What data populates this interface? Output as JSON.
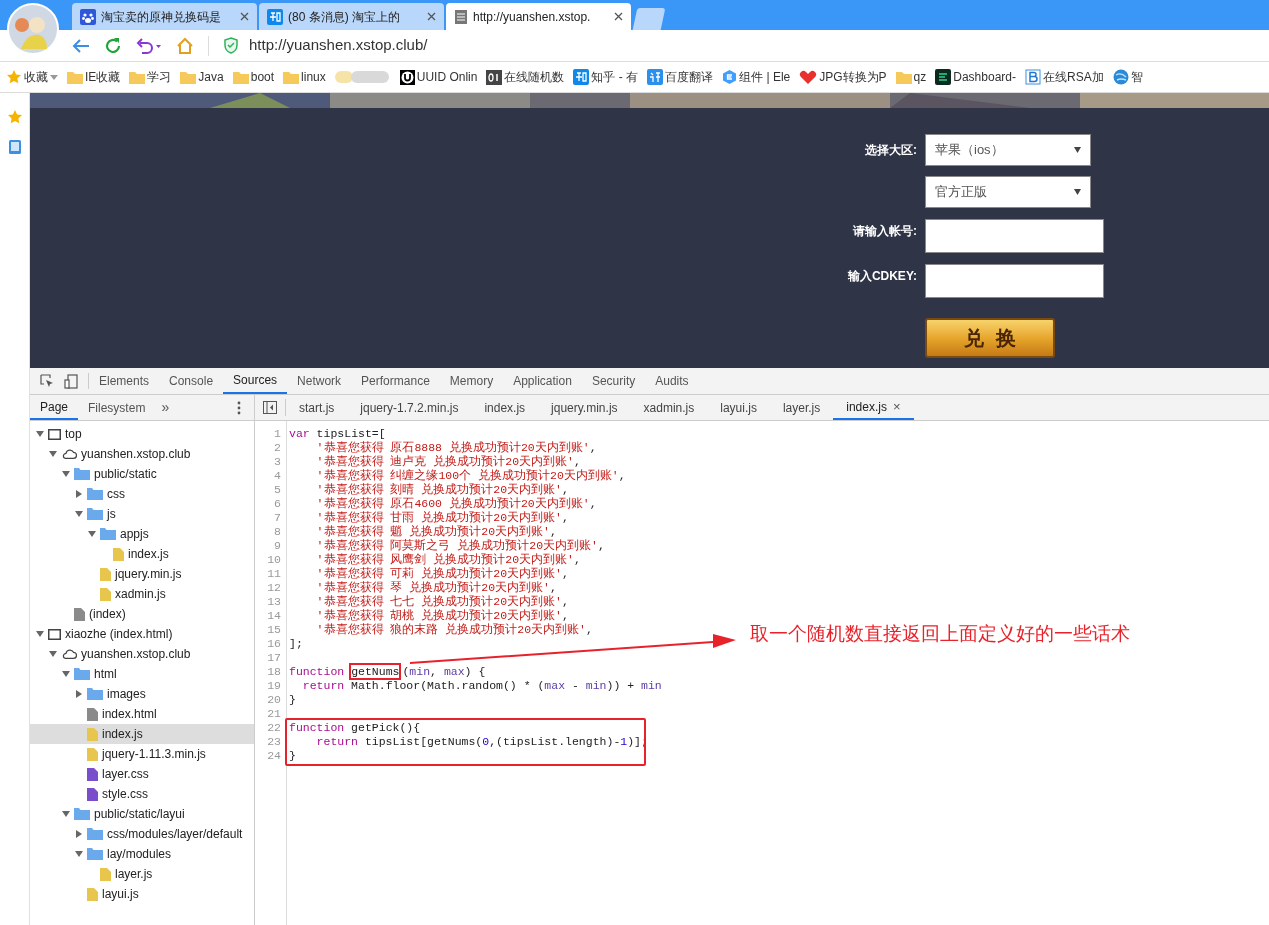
{
  "browser": {
    "tabs": [
      {
        "title": "淘宝卖的原神兑换码是",
        "kind": "paw",
        "selected": false
      },
      {
        "title": "(80 条消息) 淘宝上的",
        "kind": "zhihu",
        "selected": false
      },
      {
        "title": "http://yuanshen.xstop.",
        "kind": "page",
        "selected": true
      }
    ],
    "address": {
      "url": "http://yuanshen.xstop.club/"
    },
    "bookmarks": [
      {
        "label": "收藏",
        "kind": "star",
        "menu": true
      },
      {
        "label": "IE收藏",
        "kind": "folder"
      },
      {
        "label": "学习",
        "kind": "folder"
      },
      {
        "label": "Java",
        "kind": "folder"
      },
      {
        "label": "boot",
        "kind": "folder"
      },
      {
        "label": "linux",
        "kind": "folder"
      },
      {
        "kind": "blurred"
      },
      {
        "label": "UUID Onlin",
        "kind": "uuid"
      },
      {
        "label": "在线随机数",
        "kind": "binary"
      },
      {
        "label": "知乎 - 有",
        "kind": "zhihu"
      },
      {
        "label": "百度翻译",
        "kind": "translate"
      },
      {
        "label": "组件 | Ele",
        "kind": "element"
      },
      {
        "label": "JPG转换为P",
        "kind": "heart"
      },
      {
        "label": "qz",
        "kind": "folder"
      },
      {
        "label": "Dashboard-",
        "kind": "dashboard"
      },
      {
        "label": "在线RSA加",
        "kind": "b"
      },
      {
        "label": "智",
        "kind": "globe"
      }
    ]
  },
  "page": {
    "form": [
      {
        "kind": "select",
        "label": "选择大区:",
        "value": "苹果（ios）"
      },
      {
        "kind": "select",
        "value": "官方正版"
      },
      {
        "kind": "input",
        "label": "请输入帐号:"
      },
      {
        "kind": "input",
        "label": "输入CDKEY:"
      }
    ],
    "button": "兑  换"
  },
  "devtools": {
    "panel_tabs": [
      {
        "label": "Elements",
        "selected": false
      },
      {
        "label": "Console",
        "selected": false
      },
      {
        "label": "Sources",
        "selected": true
      },
      {
        "label": "Network",
        "selected": false
      },
      {
        "label": "Performance",
        "selected": false
      },
      {
        "label": "Memory",
        "selected": false
      },
      {
        "label": "Application",
        "selected": false
      },
      {
        "label": "Security",
        "selected": false
      },
      {
        "label": "Audits",
        "selected": false
      }
    ],
    "navigator_tabs": [
      {
        "label": "Page",
        "selected": true
      },
      {
        "label": "Filesystem",
        "selected": false
      }
    ],
    "navigator_more": "»",
    "editor_tabs": [
      {
        "label": "start.js",
        "selected": false
      },
      {
        "label": "jquery-1.7.2.min.js",
        "selected": false
      },
      {
        "label": "index.js",
        "selected": false
      },
      {
        "label": "jquery.min.js",
        "selected": false
      },
      {
        "label": "xadmin.js",
        "selected": false
      },
      {
        "label": "layui.js",
        "selected": false
      },
      {
        "label": "layer.js",
        "selected": false
      },
      {
        "label": "index.js",
        "selected": true,
        "close": "×"
      }
    ],
    "file_tree": [
      {
        "kind": "frame",
        "label": "top",
        "expanded": true,
        "children": [
          {
            "kind": "domain",
            "label": "yuanshen.xstop.club",
            "expanded": true,
            "children": [
              {
                "kind": "folder",
                "label": "public/static",
                "expanded": true,
                "children": [
                  {
                    "kind": "folder",
                    "label": "css",
                    "expanded": false
                  },
                  {
                    "kind": "folder",
                    "label": "js",
                    "expanded": true,
                    "children": [
                      {
                        "kind": "folder",
                        "label": "appjs",
                        "expanded": true,
                        "children": [
                          {
                            "kind": "script",
                            "label": "index.js",
                            "selected": false
                          }
                        ]
                      },
                      {
                        "kind": "script",
                        "label": "jquery.min.js",
                        "selected": false
                      },
                      {
                        "kind": "script",
                        "label": "xadmin.js",
                        "selected": false
                      }
                    ]
                  }
                ]
              },
              {
                "kind": "document",
                "label": "(index)",
                "selected": false
              }
            ]
          }
        ]
      },
      {
        "kind": "frame",
        "label": "xiaozhe (index.html)",
        "expanded": true,
        "children": [
          {
            "kind": "domain",
            "label": "yuanshen.xstop.club",
            "expanded": true,
            "children": [
              {
                "kind": "folder",
                "label": "html",
                "expanded": true,
                "children": [
                  {
                    "kind": "folder",
                    "label": "images",
                    "expanded": false
                  },
                  {
                    "kind": "document",
                    "label": "index.html",
                    "selected": false
                  },
                  {
                    "kind": "script",
                    "label": "index.js",
                    "selected": true
                  },
                  {
                    "kind": "script",
                    "label": "jquery-1.11.3.min.js",
                    "selected": false
                  },
                  {
                    "kind": "style",
                    "label": "layer.css",
                    "selected": false
                  },
                  {
                    "kind": "style",
                    "label": "style.css",
                    "selected": false
                  }
                ]
              },
              {
                "kind": "folder",
                "label": "public/static/layui",
                "expanded": true,
                "children": [
                  {
                    "kind": "folder",
                    "label": "css/modules/layer/default",
                    "expanded": false
                  },
                  {
                    "kind": "folder",
                    "label": "lay/modules",
                    "expanded": true,
                    "children": [
                      {
                        "kind": "script",
                        "label": "layer.js",
                        "selected": false
                      }
                    ]
                  },
                  {
                    "kind": "script",
                    "label": "layui.js",
                    "selected": false
                  }
                ]
              }
            ]
          }
        ]
      }
    ],
    "code": [
      {
        "number": "1",
        "segments": [
          {
            "kind": "keyword",
            "text": "var"
          },
          {
            "kind": "plain",
            "text": " tipsList=["
          }
        ]
      },
      {
        "number": "2",
        "segments": [
          {
            "kind": "string",
            "text": "    '恭喜您获得 原石8888 兑换成功预计20天内到账'"
          },
          {
            "kind": "plain",
            "text": ","
          }
        ]
      },
      {
        "number": "3",
        "segments": [
          {
            "kind": "string",
            "text": "    '恭喜您获得 迪卢克 兑换成功预计20天内到账'"
          },
          {
            "kind": "plain",
            "text": ","
          }
        ]
      },
      {
        "number": "4",
        "segments": [
          {
            "kind": "string",
            "text": "    '恭喜您获得 纠缠之缘100个 兑换成功预计20天内到账'"
          },
          {
            "kind": "plain",
            "text": ","
          }
        ]
      },
      {
        "number": "5",
        "segments": [
          {
            "kind": "string",
            "text": "    '恭喜您获得 刻晴 兑换成功预计20天内到账'"
          },
          {
            "kind": "plain",
            "text": ","
          }
        ]
      },
      {
        "number": "6",
        "segments": [
          {
            "kind": "string",
            "text": "    '恭喜您获得 原石4600 兑换成功预计20天内到账'"
          },
          {
            "kind": "plain",
            "text": ","
          }
        ]
      },
      {
        "number": "7",
        "segments": [
          {
            "kind": "string",
            "text": "    '恭喜您获得 甘雨 兑换成功预计20天内到账'"
          },
          {
            "kind": "plain",
            "text": ","
          }
        ]
      },
      {
        "number": "8",
        "segments": [
          {
            "kind": "string",
            "text": "    '恭喜您获得 魈 兑换成功预计20天内到账'"
          },
          {
            "kind": "plain",
            "text": ","
          }
        ]
      },
      {
        "number": "9",
        "segments": [
          {
            "kind": "string",
            "text": "    '恭喜您获得 阿莫斯之弓 兑换成功预计20天内到账'"
          },
          {
            "kind": "plain",
            "text": ","
          }
        ]
      },
      {
        "number": "10",
        "segments": [
          {
            "kind": "string",
            "text": "    '恭喜您获得 风鹰剑 兑换成功预计20天内到账'"
          },
          {
            "kind": "plain",
            "text": ","
          }
        ]
      },
      {
        "number": "11",
        "segments": [
          {
            "kind": "string",
            "text": "    '恭喜您获得 可莉 兑换成功预计20天内到账'"
          },
          {
            "kind": "plain",
            "text": ","
          }
        ]
      },
      {
        "number": "12",
        "segments": [
          {
            "kind": "string",
            "text": "    '恭喜您获得 琴 兑换成功预计20天内到账'"
          },
          {
            "kind": "plain",
            "text": ","
          }
        ]
      },
      {
        "number": "13",
        "segments": [
          {
            "kind": "string",
            "text": "    '恭喜您获得 七七 兑换成功预计20天内到账'"
          },
          {
            "kind": "plain",
            "text": ","
          }
        ]
      },
      {
        "number": "14",
        "segments": [
          {
            "kind": "string",
            "text": "    '恭喜您获得 胡桃 兑换成功预计20天内到账'"
          },
          {
            "kind": "plain",
            "text": ","
          }
        ]
      },
      {
        "number": "15",
        "segments": [
          {
            "kind": "string",
            "text": "    '恭喜您获得 狼的末路 兑换成功预计20天内到账'"
          },
          {
            "kind": "plain",
            "text": ","
          }
        ]
      },
      {
        "number": "16",
        "segments": [
          {
            "kind": "plain",
            "text": "];"
          }
        ]
      },
      {
        "number": "17"
      },
      {
        "number": "18",
        "segments": [
          {
            "kind": "keyword",
            "text": "function "
          },
          {
            "kind": "plain",
            "text": "getNums",
            "highlighted": true
          },
          {
            "kind": "plain",
            "text": "("
          },
          {
            "kind": "param",
            "text": "min"
          },
          {
            "kind": "plain",
            "text": ", "
          },
          {
            "kind": "param",
            "text": "max"
          },
          {
            "kind": "plain",
            "text": ") {"
          }
        ]
      },
      {
        "number": "19",
        "segments": [
          {
            "kind": "keyword",
            "text": "  return"
          },
          {
            "kind": "plain",
            "text": " Math.floor(Math.random() * ("
          },
          {
            "kind": "param",
            "text": "max"
          },
          {
            "kind": "plain",
            "text": " - "
          },
          {
            "kind": "param",
            "text": "min"
          },
          {
            "kind": "plain",
            "text": ")) + "
          },
          {
            "kind": "param",
            "text": "min"
          }
        ]
      },
      {
        "number": "20",
        "segments": [
          {
            "kind": "plain",
            "text": "}"
          }
        ]
      },
      {
        "number": "21"
      },
      {
        "number": "22",
        "segments": [
          {
            "kind": "keyword",
            "text": "function"
          },
          {
            "kind": "plain",
            "text": " getPick(){"
          }
        ]
      },
      {
        "number": "23",
        "segments": [
          {
            "kind": "keyword",
            "text": "    return"
          },
          {
            "kind": "plain",
            "text": " tipsList[getNums("
          },
          {
            "kind": "number",
            "text": "0"
          },
          {
            "kind": "plain",
            "text": ",(tipsList.length)-"
          },
          {
            "kind": "number",
            "text": "1"
          },
          {
            "kind": "plain",
            "text": ")];"
          }
        ]
      },
      {
        "number": "24",
        "segments": [
          {
            "kind": "plain",
            "text": "}"
          }
        ]
      }
    ],
    "annotation": "取一个随机数直接返回上面定义好的一些话术"
  }
}
